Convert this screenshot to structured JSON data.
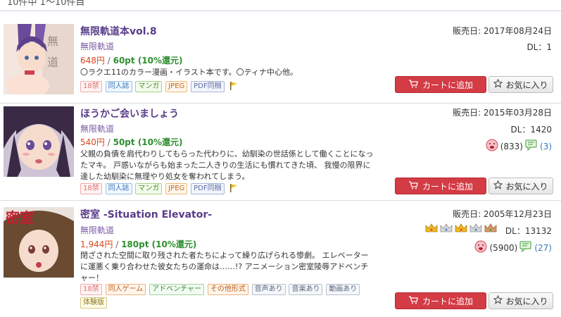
{
  "header": {
    "count_text": "10件中 1～10件目"
  },
  "buttons": {
    "cart": "カートに追加",
    "fav": "お気に入り"
  },
  "items": [
    {
      "title": "無限軌道本vol.8",
      "circle": "無限軌道",
      "price": "648円",
      "sep": "/",
      "points": "60pt (10%還元)",
      "desc": "〇ラクエ11のカラー漫画・イラスト本です。〇ティナ中心他。",
      "tags": [
        "18禁",
        "同人誌",
        "マンガ",
        "JPEG",
        "PDF同梱"
      ],
      "date": "販売日: 2017年08月24日",
      "dl": "DL：1"
    },
    {
      "title": "ほうかご会いましょう",
      "circle": "無限軌道",
      "price": "540円",
      "sep": "/",
      "points": "50pt (10%還元)",
      "desc": "父親の負債を肩代わりしてもらった代わりに、幼馴染の世話係として働くことになったマキ。 戸惑いながらも始まった二人きりの生活にも慣れてきた頃、 我慢の限界に達した幼馴染に無理やり処女を奪われてしまう。",
      "tags": [
        "18禁",
        "同人誌",
        "マンガ",
        "JPEG",
        "PDF同梱"
      ],
      "date": "販売日: 2015年03月28日",
      "dl": "DL：1420",
      "rating_count": "(833)",
      "review_count": "(3)"
    },
    {
      "title": "密室 -Situation Elevator-",
      "circle": "無限軌道",
      "price": "1,944円",
      "sep": "/",
      "points": "180pt (10%還元)",
      "desc": "閉ざされた空間に取り残された者たちによって繰り広げられる惨劇。 エレベーターに運悪く乗り合わせた彼女たちの運命は……!? アニメーション密室陵辱アドベンチャー！",
      "tags": [
        "18禁",
        "同人ゲーム",
        "アドベンチャー",
        "その他形式",
        "音声あり",
        "音楽あり",
        "動画あり",
        "体験版"
      ],
      "date": "販売日: 2005年12月23日",
      "dl": "DL：13132",
      "rating_count": "(5900)",
      "review_count": "(27)",
      "thumb_logo": "密室"
    }
  ],
  "colors": {
    "cart": "#d33b45",
    "title": "#5a3c8a",
    "price": "#d9481f",
    "points": "#2f8f2f"
  }
}
